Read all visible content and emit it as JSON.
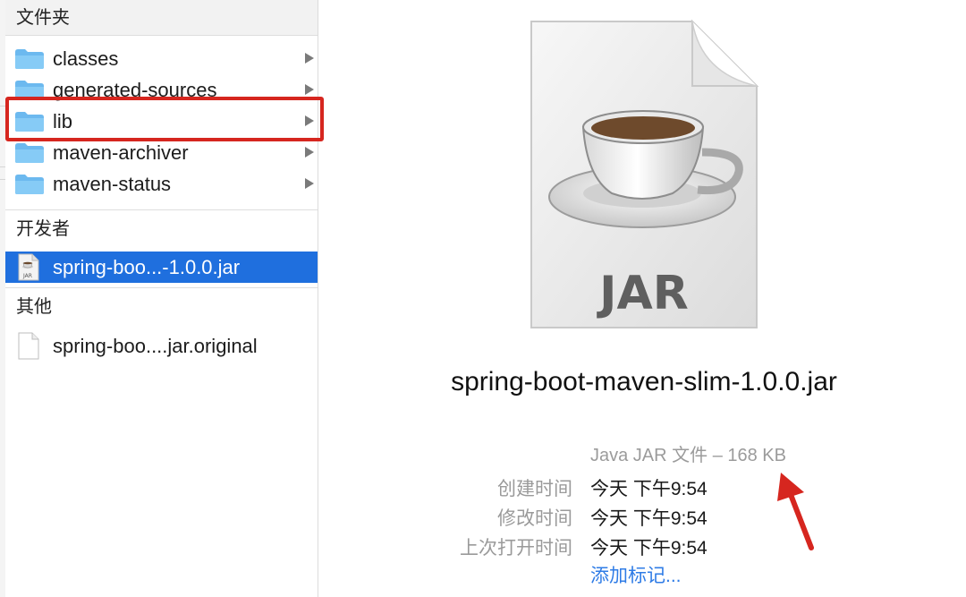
{
  "sidebar": {
    "folders_header": "文件夹",
    "folders": [
      {
        "label": "classes"
      },
      {
        "label": "generated-sources"
      },
      {
        "label": "lib"
      },
      {
        "label": "maven-archiver"
      },
      {
        "label": "maven-status"
      }
    ],
    "developer_header": "开发者",
    "developer_items": [
      {
        "label": "spring-boo...-1.0.0.jar",
        "icon_text": "JAR",
        "selected": true
      }
    ],
    "other_header": "其他",
    "other_items": [
      {
        "label": "spring-boo....jar.original"
      }
    ]
  },
  "preview": {
    "icon_label": "JAR",
    "file_name": "spring-boot-maven-slim-1.0.0.jar",
    "kind_size": "Java JAR 文件 – 168 KB",
    "meta": [
      {
        "key": "创建时间",
        "value": "今天 下午9:54"
      },
      {
        "key": "修改时间",
        "value": "今天 下午9:54"
      },
      {
        "key": "上次打开时间",
        "value": "今天 下午9:54"
      }
    ],
    "add_tags": "添加标记..."
  },
  "colors": {
    "selection": "#1f6fde",
    "highlight_box": "#d6261f",
    "arrow": "#d6261f",
    "folder": "#7cc3f3",
    "link": "#2f7ce6"
  }
}
